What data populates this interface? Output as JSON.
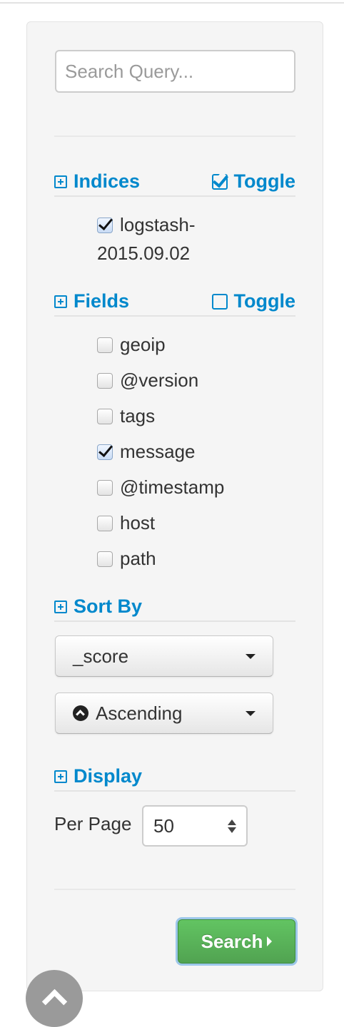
{
  "search": {
    "placeholder": "Search Query...",
    "value": ""
  },
  "indices": {
    "title": "Indices",
    "toggle_label": "Toggle",
    "toggle_checked": true,
    "items": [
      {
        "label_line1": "logstash-",
        "label_line2": "2015.09.02",
        "checked": true
      }
    ]
  },
  "fields": {
    "title": "Fields",
    "toggle_label": "Toggle",
    "toggle_checked": false,
    "items": [
      {
        "label": "geoip",
        "checked": false
      },
      {
        "label": "@version",
        "checked": false
      },
      {
        "label": "tags",
        "checked": false
      },
      {
        "label": "message",
        "checked": true
      },
      {
        "label": "@timestamp",
        "checked": false
      },
      {
        "label": "host",
        "checked": false
      },
      {
        "label": "path",
        "checked": false
      }
    ]
  },
  "sort": {
    "title": "Sort By",
    "field_value": "_score",
    "order_value": "Ascending"
  },
  "display": {
    "title": "Display",
    "per_page_label": "Per Page",
    "per_page_value": "50"
  },
  "search_button": {
    "label": "Search"
  },
  "colors": {
    "link": "#0088cc",
    "button": "#51a351",
    "panel": "#f5f5f5"
  }
}
